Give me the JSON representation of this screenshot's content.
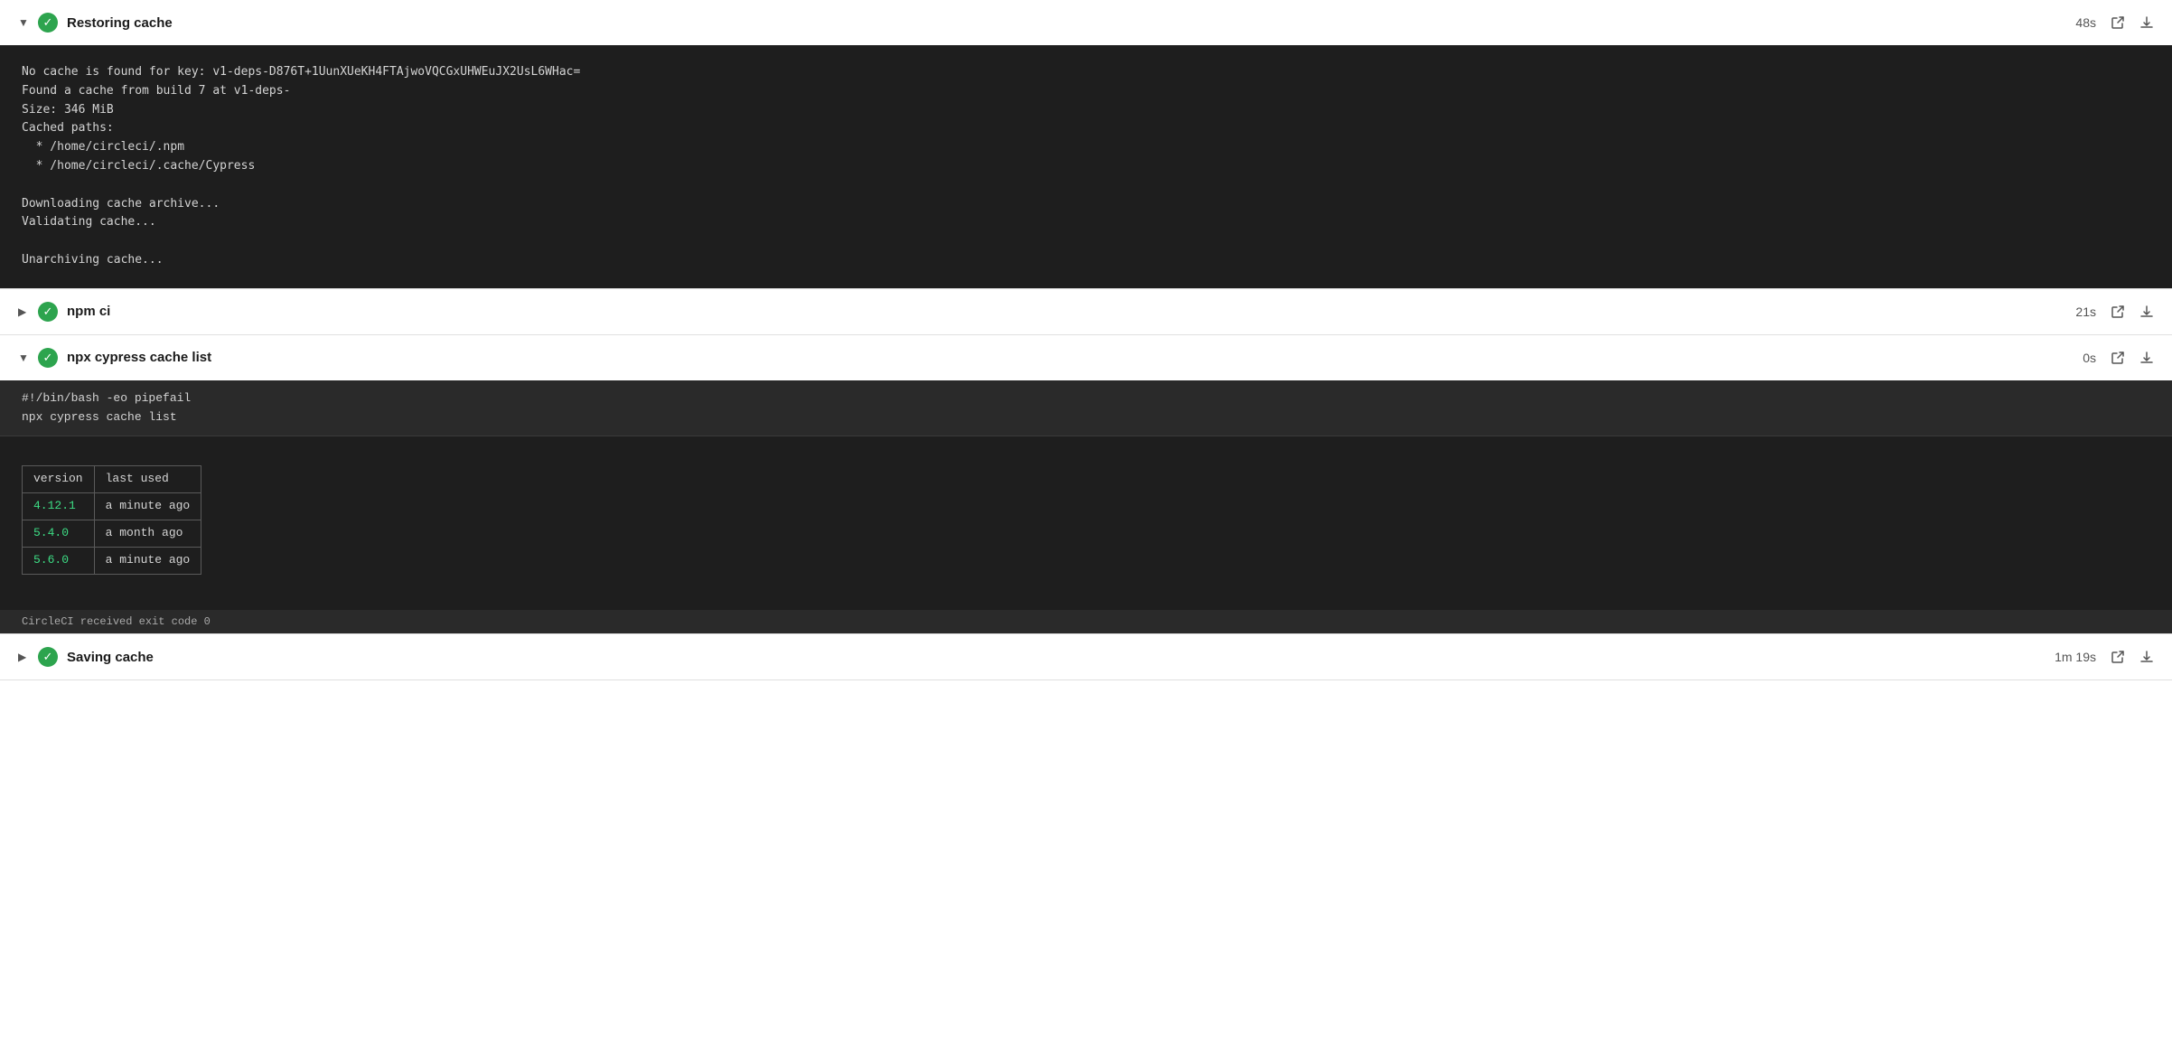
{
  "sections": [
    {
      "id": "restoring-cache",
      "title": "Restoring cache",
      "duration": "48s",
      "expanded": true,
      "status": "success",
      "chevron": "▼",
      "terminal_content": "No cache is found for key: v1-deps-D876T+1UunXUeKH4FTAjwoVQCGxUHWEuJX2UsL6WHac=\nFound a cache from build 7 at v1-deps-\nSize: 346 MiB\nCached paths:\n  * /home/circleci/.npm\n  * /home/circleci/.cache/Cypress\n\nDownloading cache archive...\nValidating cache...\n\nUnarchiving cache...",
      "has_table": false,
      "has_script": false,
      "exit_code": null
    },
    {
      "id": "npm-ci",
      "title": "npm ci",
      "duration": "21s",
      "expanded": false,
      "status": "success",
      "chevron": "▶",
      "terminal_content": null,
      "has_table": false,
      "has_script": false,
      "exit_code": null
    },
    {
      "id": "npx-cypress-cache-list",
      "title": "npx cypress cache list",
      "duration": "0s",
      "expanded": true,
      "status": "success",
      "chevron": "▼",
      "script_lines": [
        "#!/bin/bash -eo pipefail",
        "npx cypress cache list"
      ],
      "terminal_content": "",
      "has_table": true,
      "table": {
        "headers": [
          "version",
          "last used"
        ],
        "rows": [
          {
            "version": "4.12.1",
            "last_used": "a minute ago"
          },
          {
            "version": "5.4.0",
            "last_used": "a month ago"
          },
          {
            "version": "5.6.0",
            "last_used": "a minute ago"
          }
        ]
      },
      "exit_code": "CircleCI received exit code 0"
    },
    {
      "id": "saving-cache",
      "title": "Saving cache",
      "duration": "1m 19s",
      "expanded": false,
      "status": "success",
      "chevron": "▶",
      "terminal_content": null,
      "has_table": false,
      "has_script": false,
      "exit_code": null
    }
  ],
  "icons": {
    "expand": "▶",
    "collapse": "▼",
    "check": "✓",
    "external_link": "⬡",
    "download": "⬇"
  }
}
